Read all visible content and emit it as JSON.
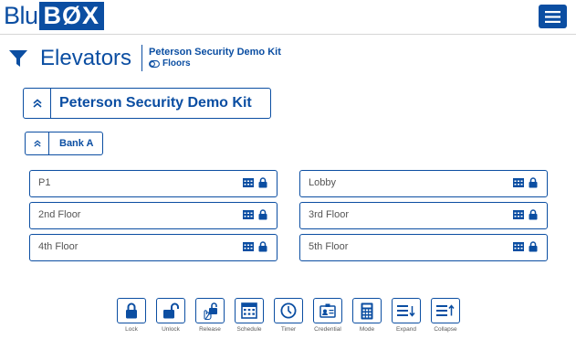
{
  "brand": {
    "logo_left": "Blu",
    "logo_right": "BØX",
    "primary_color": "#0b4ea2"
  },
  "topbar": {
    "menu_icon": "hamburger-menu-icon"
  },
  "header": {
    "title": "Elevators",
    "breadcrumb_site": "Peterson Security Demo Kit",
    "breadcrumb_section": "Floors",
    "filter_icon": "filter-icon",
    "section_icon": "toggle-icon"
  },
  "site": {
    "name": "Peterson Security Demo Kit"
  },
  "bank": {
    "name": "Bank A"
  },
  "floors": [
    {
      "name": "P1"
    },
    {
      "name": "Lobby"
    },
    {
      "name": "2nd Floor"
    },
    {
      "name": "3rd Floor"
    },
    {
      "name": "4th Floor"
    },
    {
      "name": "5th Floor"
    }
  ],
  "toolbar": {
    "buttons": [
      {
        "label": "Lock",
        "icon": "lock-icon"
      },
      {
        "label": "Unlock",
        "icon": "unlock-icon"
      },
      {
        "label": "Release",
        "icon": "release-icon"
      },
      {
        "label": "Schedule",
        "icon": "schedule-icon"
      },
      {
        "label": "Timer",
        "icon": "timer-icon"
      },
      {
        "label": "Credential",
        "icon": "credential-icon"
      },
      {
        "label": "Mode",
        "icon": "mode-icon"
      },
      {
        "label": "Expand",
        "icon": "expand-icon"
      },
      {
        "label": "Collapse",
        "icon": "collapse-icon"
      }
    ]
  }
}
